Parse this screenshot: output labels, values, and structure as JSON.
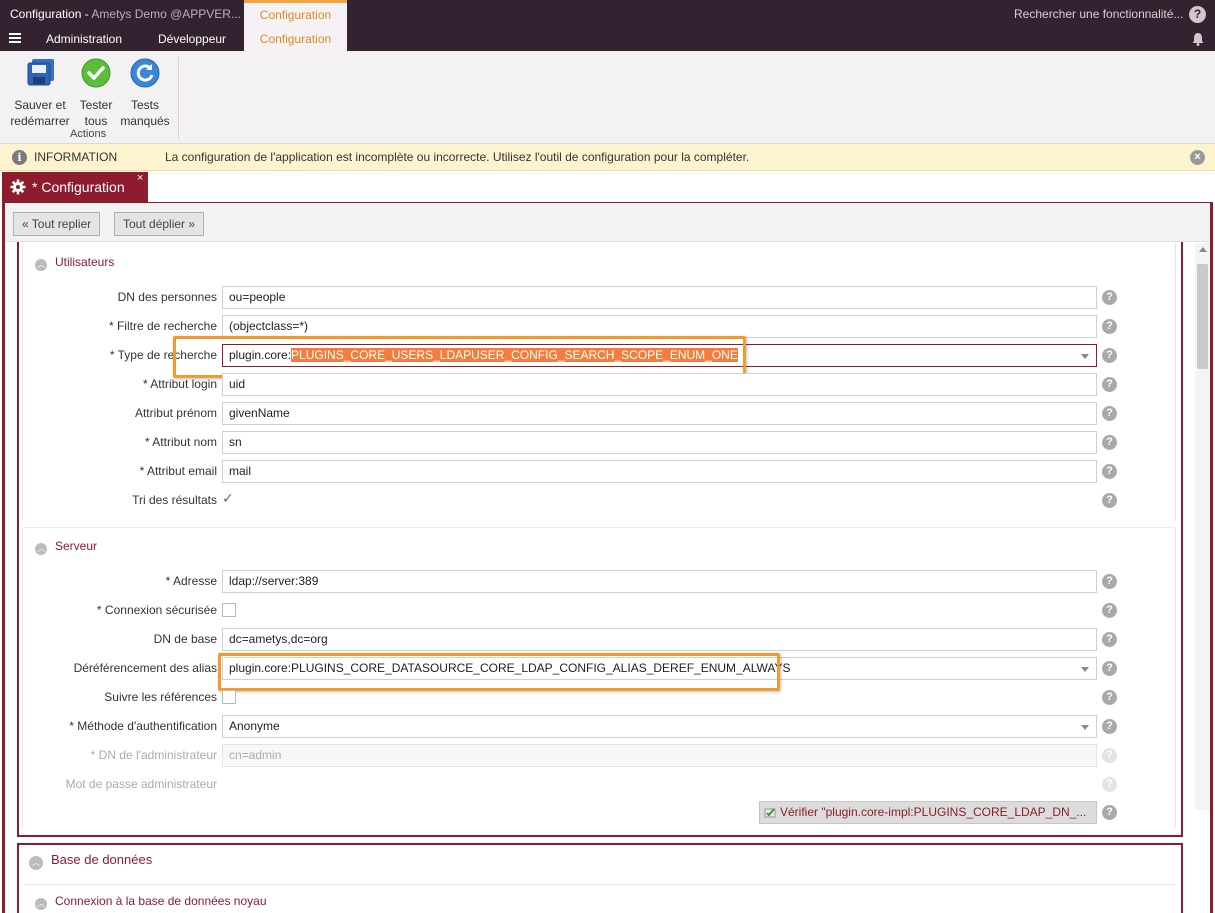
{
  "window": {
    "title_main": "Configuration",
    "title_dash": " - ",
    "title_sub": "Ametys Demo @APPVER...",
    "context_title": "Configuration"
  },
  "menu": {
    "tabs": [
      {
        "label": "Administration"
      },
      {
        "label": "Développeur"
      },
      {
        "label": "Configuration"
      }
    ],
    "search_placeholder": "Rechercher une fonctionnalité...",
    "help": "?"
  },
  "ribbon": {
    "buttons": [
      {
        "line1": "Sauver et",
        "line2": "redémarrer",
        "icon": "save-restart-icon"
      },
      {
        "line1": "Tester",
        "line2": "tous",
        "icon": "check-icon"
      },
      {
        "line1": "Tests",
        "line2": "manqués",
        "icon": "refresh-icon"
      }
    ],
    "group_label": "Actions"
  },
  "info": {
    "label": "INFORMATION",
    "message": "La configuration de l'application est incomplète ou incorrecte. Utilisez l'outil de configuration pour la compléter."
  },
  "doc_tab": {
    "label": "* Configuration",
    "close": "×"
  },
  "toolbar": {
    "collapse_all": "« Tout replier",
    "expand_all": "Tout déplier »"
  },
  "users_section": {
    "title": "Utilisateurs",
    "rows": [
      {
        "label": "DN des personnes",
        "value": "ou=people"
      },
      {
        "label": "* Filtre de recherche",
        "value": "(objectclass=*)"
      },
      {
        "label": "* Type de recherche",
        "value_prefix": "plugin.core:",
        "value_highlight": "PLUGINS_CORE_USERS_LDAPUSER_CONFIG_SEARCH_SCOPE_ENUM_ONE"
      },
      {
        "label": "* Attribut login",
        "value": "uid"
      },
      {
        "label": "Attribut prénom",
        "value": "givenName"
      },
      {
        "label": "* Attribut nom",
        "value": "sn"
      },
      {
        "label": "* Attribut email",
        "value": "mail"
      },
      {
        "label": "Tri des résultats",
        "checked": "✓"
      }
    ]
  },
  "server_section": {
    "title": "Serveur",
    "rows": [
      {
        "label": "* Adresse",
        "value": "ldap://server:389"
      },
      {
        "label": "* Connexion sécurisée",
        "checked": false
      },
      {
        "label": "DN de base",
        "value": "dc=ametys,dc=org"
      },
      {
        "label": "Déréférencement des alias",
        "value": "plugin.core:PLUGINS_CORE_DATASOURCE_CORE_LDAP_CONFIG_ALIAS_DEREF_ENUM_ALWAYS"
      },
      {
        "label": "Suivre les références",
        "checked": false
      },
      {
        "label": "* Méthode d'authentification",
        "value": "Anonyme"
      },
      {
        "label": "* DN de l'administrateur",
        "value": "cn=admin",
        "disabled": true
      },
      {
        "label": "Mot de passe administrateur",
        "value": "",
        "disabled": true
      }
    ],
    "verify_button": "Vérifier \"plugin.core-impl:PLUGINS_CORE_LDAP_DN_..."
  },
  "db_panel": {
    "title": "Base de données",
    "subsection": "Connexion à la base de données noyau"
  },
  "colors": {
    "brand": "#8c1c2e",
    "accent": "#e08a1e",
    "topbar": "#33222f",
    "highlight": "#f47c3c"
  }
}
